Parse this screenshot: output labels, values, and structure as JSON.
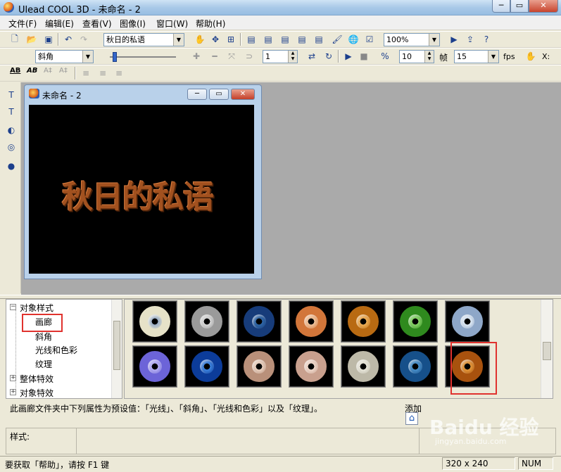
{
  "window": {
    "title": "Ulead COOL 3D - 未命名 - 2",
    "min": "─",
    "max": "▭",
    "close": "✕"
  },
  "menu": [
    "文件(F)",
    "编辑(E)",
    "查看(V)",
    "图像(I)",
    "窗口(W)",
    "帮助(H)"
  ],
  "toolbar1": {
    "text_combo": "秋日的私语",
    "zoom_combo": "100%"
  },
  "toolbar2": {
    "bevel_combo": "斜角",
    "frame_value": "1",
    "frames_value": "10",
    "frames_label": "帧",
    "fps_value": "15",
    "fps_label": "fps",
    "x_label": "X:"
  },
  "toolbar3": {
    "ab1": "AB",
    "ab2": "AB",
    "a1": "A‡",
    "a2": "A‡"
  },
  "child": {
    "title": "未命名 - 2",
    "canvas_text": "秋日的私语",
    "min": "─",
    "max": "▭",
    "close": "✕"
  },
  "tree": {
    "items": [
      {
        "label": "对象样式",
        "toggle": "−"
      },
      {
        "label": "画廊"
      },
      {
        "label": "斜角"
      },
      {
        "label": "光线和色彩"
      },
      {
        "label": "纹理"
      },
      {
        "label": "整体特效",
        "toggle": "+"
      },
      {
        "label": "对象特效",
        "toggle": "+"
      }
    ]
  },
  "gallery": {
    "thumbs": [
      {
        "outer": "#e6e2c8",
        "inner": "#9aaec8"
      },
      {
        "outer": "#9a9a9a",
        "inner": "#d8d8d8"
      },
      {
        "outer": "#173c7a",
        "inner": "#2f67a8"
      },
      {
        "outer": "#d2763a",
        "inner": "#f0c6a0"
      },
      {
        "outer": "#b86a12",
        "inner": "#f0b25a"
      },
      {
        "outer": "#2f8a1e",
        "inner": "#8cd86a"
      },
      {
        "outer": "#8ea7c8",
        "inner": "#e2ecf6"
      },
      {
        "outer": "#6c64d8",
        "inner": "#b8b2f2"
      },
      {
        "outer": "#0c3c9a",
        "inner": "#3f86e0"
      },
      {
        "outer": "#b9907a",
        "inner": "#ead2c2"
      },
      {
        "outer": "#c9a08e",
        "inner": "#efd9cc"
      },
      {
        "outer": "#bdb9a8",
        "inner": "#e8e6da"
      },
      {
        "outer": "#16508a",
        "inner": "#4b92cc"
      },
      {
        "outer": "#a8520e",
        "inner": "#e69a3c"
      }
    ]
  },
  "description": "此画廊文件夹中下列属性为预设值：「光线」、「斜角」、「光线和色彩」以及「纹理」。",
  "add": {
    "label": "添加",
    "icon": "⌂"
  },
  "props": {
    "label": "样式:"
  },
  "status": {
    "text": "要获取「帮助」，请按 F1 键",
    "size": "320 x 240",
    "num": "NUM"
  },
  "watermark": {
    "main": "Baidu 经验",
    "sub": "jingyan.baidu.com"
  },
  "colors": {
    "highlight": "#e0322e",
    "title_gradient": "#a9c9e8"
  }
}
